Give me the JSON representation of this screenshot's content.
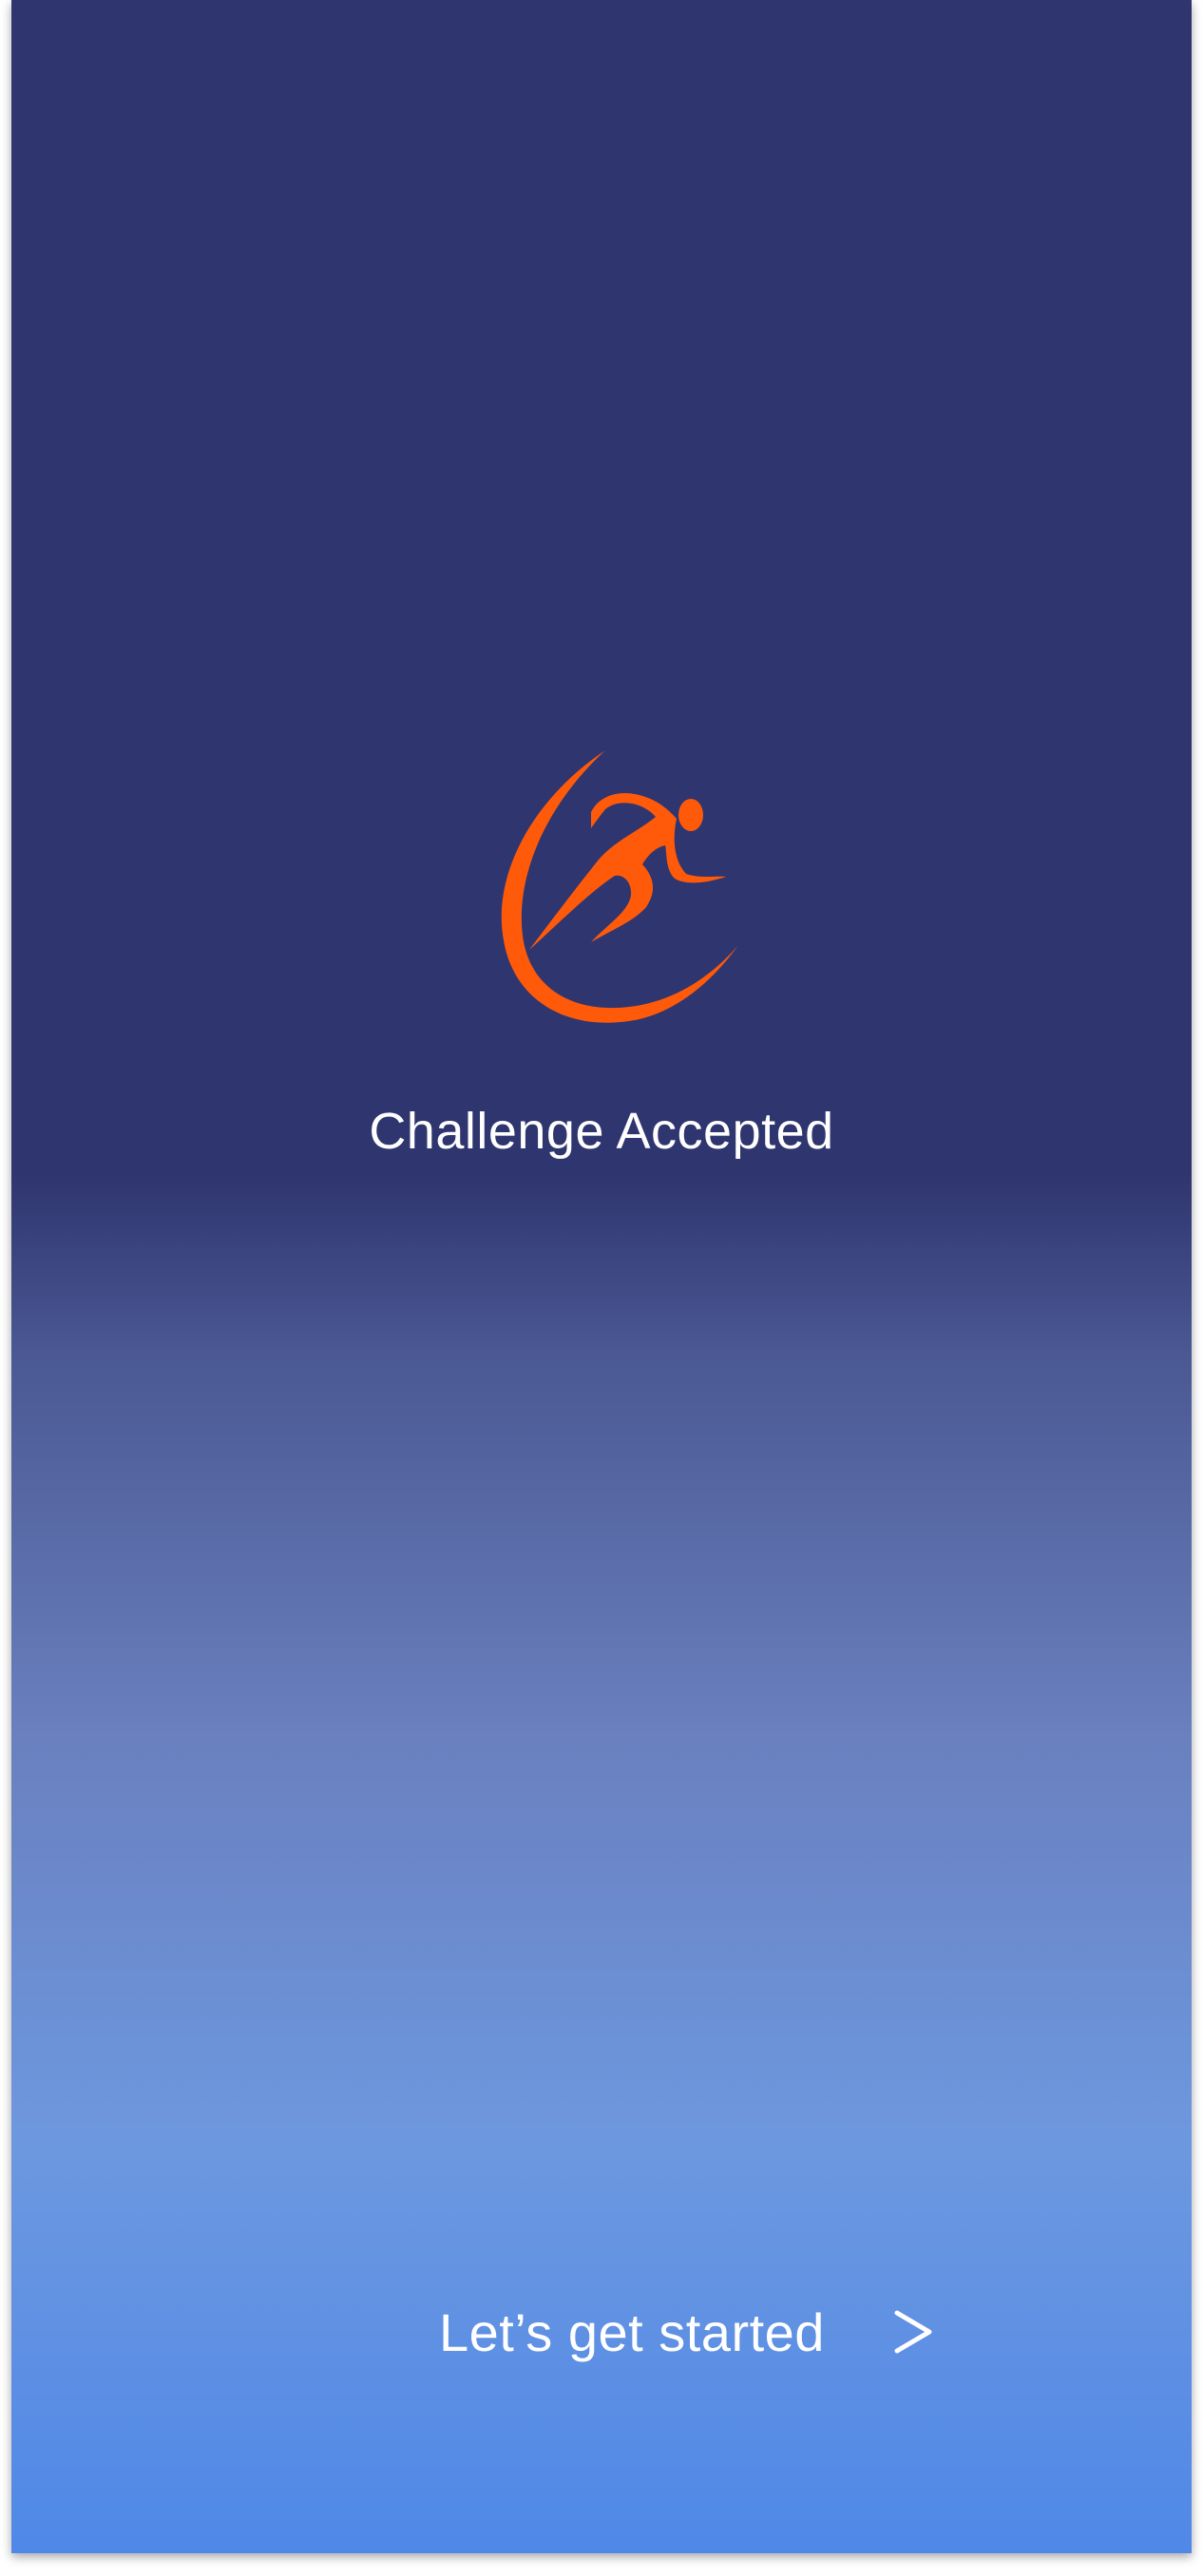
{
  "app": {
    "name": "Challenge Accepted"
  },
  "logo": {
    "icon": "runner-logo-icon",
    "color": "#ff5a0a"
  },
  "cta": {
    "label": "Let’s get started",
    "icon": "chevron-right-icon"
  },
  "colors": {
    "background_top": "#2f356f",
    "background_bottom": "#4f88e8",
    "text": "#ffffff"
  }
}
